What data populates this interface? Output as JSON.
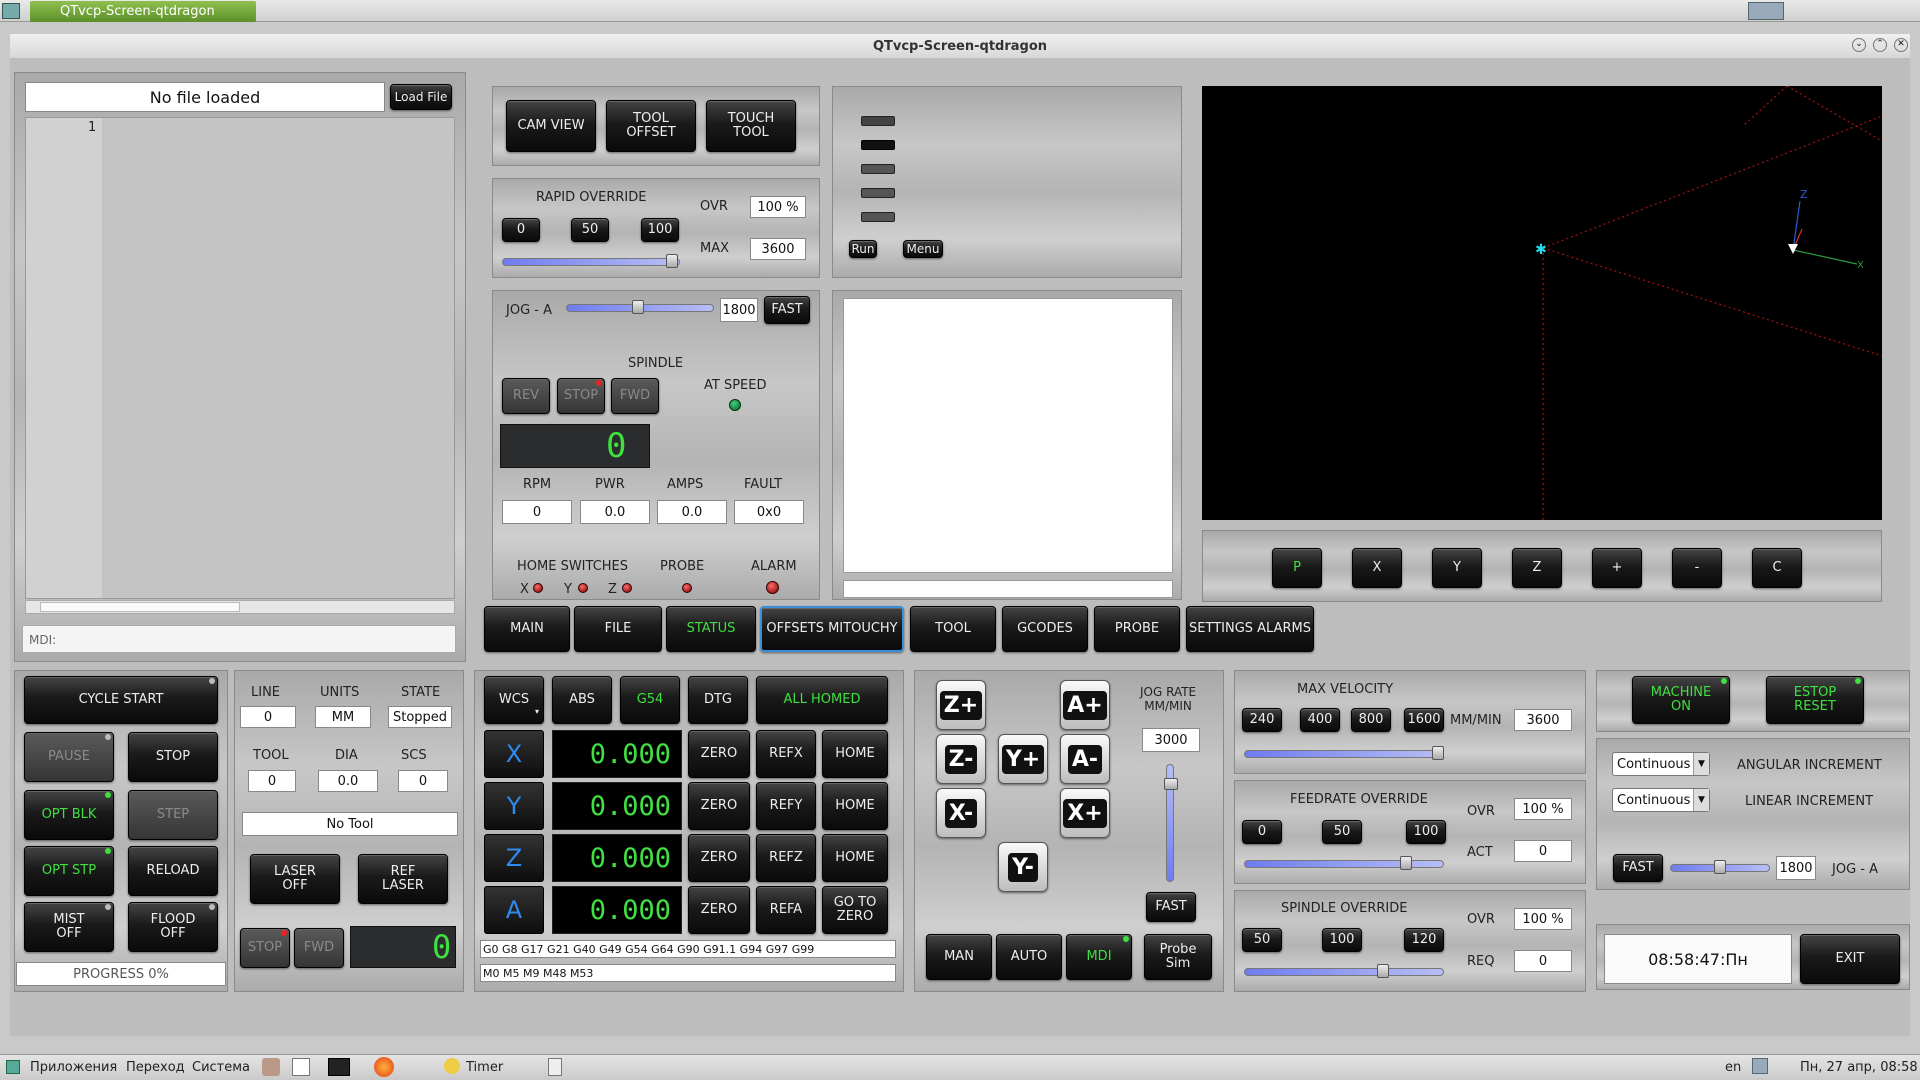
{
  "taskbar_top": {
    "title": "QTvcp-Screen-qtdragon"
  },
  "window": {
    "title": "QTvcp-Screen-qtdragon"
  },
  "file": {
    "name": "No file loaded",
    "load_label": "Load File",
    "line_no": "1",
    "mdi_label": "MDI:"
  },
  "top_buttons": {
    "cam_view": "CAM VIEW",
    "tool_offset": "TOOL\nOFFSET",
    "touch_tool": "TOUCH\nTOOL"
  },
  "rapid": {
    "title": "RAPID OVERRIDE",
    "b0": "0",
    "b50": "50",
    "b100": "100",
    "ovr_label": "OVR",
    "ovr_value": "100 %",
    "max_label": "MAX",
    "max_value": "3600",
    "level": 1.0
  },
  "jog_top": {
    "label": "JOG - A",
    "value": "1800",
    "fast": "FAST",
    "level": 0.5
  },
  "spindle": {
    "title": "SPINDLE",
    "rev": "REV",
    "stop": "STOP",
    "fwd": "FWD",
    "at_speed": "AT SPEED",
    "digit": "0",
    "rpm_label": "RPM",
    "pwr_label": "PWR",
    "amps_label": "AMPS",
    "fault_label": "FAULT",
    "rpm": "0",
    "pwr": "0.0",
    "amps": "0.0",
    "fault": "0x0"
  },
  "switches": {
    "home": "HOME SWITCHES",
    "probe": "PROBE",
    "alarm": "ALARM",
    "x": "X",
    "y": "Y",
    "z": "Z"
  },
  "macro": {
    "run": "Run",
    "menu": "Menu"
  },
  "view_buttons": [
    "P",
    "X",
    "Y",
    "Z",
    "+",
    "-",
    "C"
  ],
  "tabs": [
    "MAIN",
    "FILE",
    "STATUS",
    "OFFSETS MITOUCHY",
    "TOOL",
    "GCODES",
    "PROBE",
    "SETTINGS ALARMS"
  ],
  "cycle": {
    "start": "CYCLE  START",
    "pause": "PAUSE",
    "stop": "STOP",
    "opt_blk": "OPT BLK",
    "step": "STEP",
    "opt_stp": "OPT STP",
    "reload": "RELOAD",
    "mist": "MIST\nOFF",
    "flood": "FLOOD\nOFF",
    "progress": "PROGRESS 0%"
  },
  "status": {
    "line_label": "LINE",
    "units_label": "UNITS",
    "state_label": "STATE",
    "line": "0",
    "units": "MM",
    "state": "Stopped",
    "tool_label": "TOOL",
    "dia_label": "DIA",
    "scs_label": "SCS",
    "tool": "0",
    "dia": "0.0",
    "scs": "0",
    "tool_name": "No Tool",
    "laser_off": "LASER\nOFF",
    "ref_laser": "REF\nLASER",
    "stop": "STOP",
    "fwd": "FWD",
    "digit": "0"
  },
  "dro": {
    "wcs": "WCS",
    "abs": "ABS",
    "g54": "G54",
    "dtg": "DTG",
    "all_homed": "ALL HOMED",
    "axes": [
      {
        "name": "X",
        "value": "0.000",
        "zero": "ZERO",
        "ref": "REFX",
        "home": "HOME"
      },
      {
        "name": "Y",
        "value": "0.000",
        "zero": "ZERO",
        "ref": "REFY",
        "home": "HOME"
      },
      {
        "name": "Z",
        "value": "0.000",
        "zero": "ZERO",
        "ref": "REFZ",
        "home": "HOME"
      },
      {
        "name": "A",
        "value": "0.000",
        "zero": "ZERO",
        "ref": "REFA",
        "home": "GO TO\nZERO"
      }
    ],
    "gcodes": "G0 G8 G17 G21 G40 G49 G54 G64 G90 G91.1 G94 G97 G99",
    "mcodes": "M0 M5 M9 M48 M53"
  },
  "jog": {
    "zp": "Z+",
    "zm": "Z-",
    "ap": "A+",
    "am": "A-",
    "yp": "Y+",
    "ym": "Y-",
    "xm": "X-",
    "xp": "X+",
    "rate_label": "JOG RATE\nMM/MIN",
    "rate": "3000",
    "fast": "FAST",
    "man": "MAN",
    "auto": "AUTO",
    "mdi": "MDI",
    "probe_sim": "Probe\nSim"
  },
  "velocity": {
    "title": "MAX VELOCITY",
    "b1": "240",
    "b2": "400",
    "b3": "800",
    "b4": "1600",
    "unit": "MM/MIN",
    "value": "3600",
    "level": 1.0
  },
  "feed": {
    "title": "FEEDRATE OVERRIDE",
    "b0": "0",
    "b50": "50",
    "b100": "100",
    "ovr_label": "OVR",
    "ovr": "100 %",
    "act_label": "ACT",
    "act": "0",
    "level": 0.8
  },
  "spindle_ovr": {
    "title": "SPINDLE OVERRIDE",
    "b50": "50",
    "b100": "100",
    "b120": "120",
    "ovr_label": "OVR",
    "ovr": "100 %",
    "req_label": "REQ",
    "req": "0",
    "level": 0.7
  },
  "machine": {
    "on": "MACHINE\nON",
    "estop": "ESTOP\nRESET",
    "combo1": "Continuous",
    "combo2": "Continuous",
    "ang_inc": "ANGULAR INCREMENT",
    "lin_inc": "LINEAR INCREMENT",
    "fast": "FAST",
    "jog_value": "1800",
    "jog_label": "JOG - A",
    "time": "08:58:47:Пн",
    "exit": "EXIT",
    "jog_level": 0.55
  },
  "taskbar": {
    "apps": "Приложения",
    "go": "Переход",
    "system": "Система",
    "timer": "Timer",
    "lang": "en",
    "clock": "Пн, 27 апр, 08:58"
  },
  "colors": {
    "accent_green": "#3fe03f",
    "axis_blue": "#2d8cf0",
    "led_red": "#e02020"
  }
}
